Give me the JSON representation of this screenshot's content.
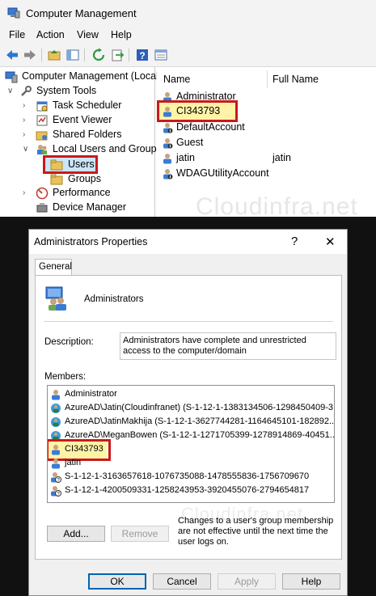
{
  "computer_management": {
    "window_title": "Computer Management",
    "menu": [
      "File",
      "Action",
      "View",
      "Help"
    ],
    "tree": {
      "root": "Computer Management (Local",
      "system_tools": "System Tools",
      "task_scheduler": "Task Scheduler",
      "event_viewer": "Event Viewer",
      "shared_folders": "Shared Folders",
      "local_users_groups": "Local Users and Groups",
      "users": "Users",
      "groups": "Groups",
      "performance": "Performance",
      "device_manager": "Device Manager"
    },
    "list": {
      "col_name": "Name",
      "col_full_name": "Full Name",
      "rows": [
        {
          "name": "Administrator",
          "full_name": ""
        },
        {
          "name": "CI343793",
          "full_name": ""
        },
        {
          "name": "DefaultAccount",
          "full_name": ""
        },
        {
          "name": "Guest",
          "full_name": ""
        },
        {
          "name": "jatin",
          "full_name": "jatin"
        },
        {
          "name": "WDAGUtilityAccount",
          "full_name": ""
        }
      ]
    },
    "watermark": "Cloudinfra.net"
  },
  "dialog": {
    "title": "Administrators Properties",
    "help_glyph": "?",
    "close_glyph": "✕",
    "tab": "General",
    "group_name": "Administrators",
    "description_label": "Description:",
    "description_value": "Administrators have complete and unrestricted access to the computer/domain",
    "members_label": "Members:",
    "members": [
      "Administrator",
      "AzureAD\\Jatin(Cloudinfranet) (S-1-12-1-1383134506-1298450409-3...",
      "AzureAD\\JatinMakhija (S-1-12-1-3627744281-1164645101-182892...",
      "AzureAD\\MeganBowen (S-1-12-1-1271705399-1278914869-40451...",
      "CI343793",
      "jatin",
      "S-1-12-1-3163657618-1076735088-1478555836-1756709670",
      "S-1-12-1-4200509331-1258243953-3920455076-2794654817"
    ],
    "watermark": "Cloudinfra.net",
    "add_button": "Add...",
    "remove_button": "Remove",
    "note": "Changes to a user's group membership are not effective until the next time the user logs on.",
    "ok_button": "OK",
    "cancel_button": "Cancel",
    "apply_button": "Apply",
    "help_button": "Help"
  },
  "colors": {
    "highlight_box": "#c91a1a",
    "selection_fill": "#fff3a8",
    "accent_blue": "#0063b1"
  }
}
